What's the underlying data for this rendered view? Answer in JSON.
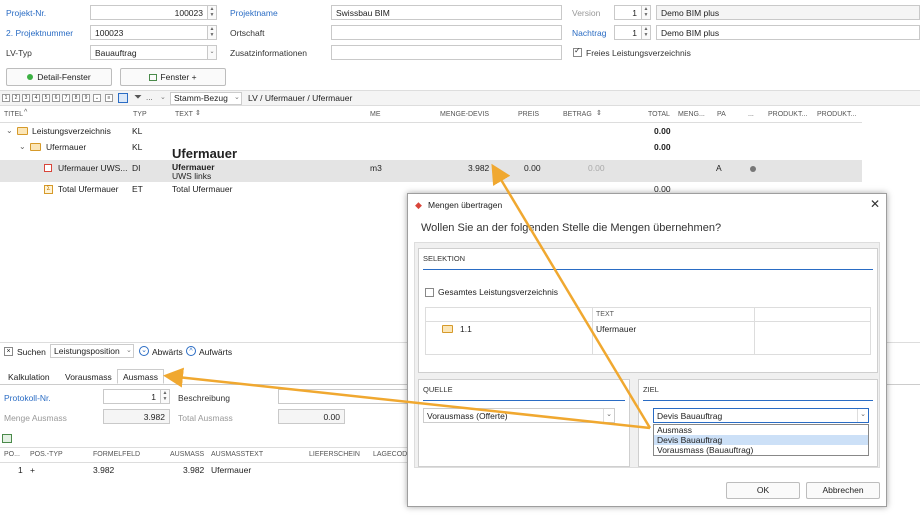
{
  "header": {
    "projekt_nr_label": "Projekt-Nr.",
    "projekt_nr_value": "100023",
    "projektname_label": "Projektname",
    "projektname_value": "Swissbau BIM",
    "version_label": "Version",
    "version_value": "1",
    "version_name": "Demo BIM plus",
    "zweite_nr_label": "2. Projektnummer",
    "zweite_nr_value": "100023",
    "ortschaft_label": "Ortschaft",
    "nachtrag_label": "Nachtrag",
    "nachtrag_value": "1",
    "nachtrag_name": "Demo BIM plus",
    "lv_typ_label": "LV-Typ",
    "lv_typ_value": "Bauauftrag",
    "zusatz_label": "Zusatzinformationen",
    "freies_lv_label": "Freies Leistungsverzeichnis",
    "detail_button": "Detail-Fenster",
    "fenster_button": "Fenster +"
  },
  "toolbar": {
    "levels": [
      "1",
      "2",
      "3",
      "4",
      "5",
      "6",
      "7",
      "8",
      "9"
    ],
    "filter_placeholder": "...",
    "stamm_bezug": "Stamm-Bezug",
    "breadcrumb": [
      "LV",
      "Ufermauer",
      "Ufermauer"
    ]
  },
  "grid": {
    "columns": [
      "TITEL",
      "TYP",
      "TEXT",
      "ME",
      "MENGE-DEVIS",
      "PREIS",
      "BETRAG",
      "TOTAL",
      "MENG...",
      "PA",
      "...",
      "PRODUKT...",
      "PRODUKT..."
    ],
    "rows": [
      {
        "titel": "Leistungsverzeichnis",
        "typ": "KL",
        "text": "",
        "me": "",
        "menge": "",
        "preis": "",
        "betrag": "",
        "total": "0.00",
        "pa": ""
      },
      {
        "titel": "Ufermauer",
        "typ": "KL",
        "text": "",
        "me": "",
        "menge": "",
        "preis": "",
        "betrag": "",
        "total": "0.00",
        "pa": ""
      },
      {
        "titel": "Ufermauer UWS...",
        "typ": "DI",
        "text": "Ufermauer",
        "text2": "UWS links",
        "me": "m3",
        "menge": "3.982",
        "preis": "0.00",
        "betrag": "0.00",
        "total": "",
        "pa": "A"
      },
      {
        "titel": "Total Ufermauer",
        "typ": "ET",
        "text": "Total Ufermauer",
        "me": "",
        "menge": "",
        "preis": "",
        "betrag": "",
        "total": "0.00",
        "pa": ""
      }
    ],
    "heading_overlay": "Ufermauer"
  },
  "search": {
    "label": "Suchen",
    "scope": "Leistungsposition",
    "down": "Abwärts",
    "up": "Aufwärts"
  },
  "tabs": [
    "Kalkulation",
    "Vorausmass",
    "Ausmass"
  ],
  "detail": {
    "protokoll_label": "Protokoll-Nr.",
    "protokoll_value": "1",
    "beschreibung_label": "Beschreibung",
    "menge_ausmass_label": "Menge Ausmass",
    "menge_ausmass_value": "3.982",
    "total_ausmass_label": "Total Ausmass",
    "total_ausmass_value": "0.00"
  },
  "bottom_grid": {
    "columns": [
      "PO...",
      "POS.-TYP",
      "FORMELFELD",
      "AUSMASS",
      "AUSMASSTEXT",
      "LIEFERSCHEIN",
      "LAGECOD"
    ],
    "rows": [
      {
        "po": "1",
        "typ": "+",
        "formel": "3.982",
        "ausmass": "3.982",
        "text": "Ufermauer"
      }
    ]
  },
  "dialog": {
    "title": "Mengen übertragen",
    "question": "Wollen Sie an der folgenden Stelle die Mengen übernehmen?",
    "selektion_title": "SELEKTION",
    "gesamt_label": "Gesamtes Leistungsverzeichnis",
    "sel_text_header": "TEXT",
    "sel_row_num": "1.1",
    "sel_row_text": "Ufermauer",
    "quelle_title": "QUELLE",
    "quelle_value": "Vorausmass (Offerte)",
    "ziel_title": "ZIEL",
    "ziel_value": "Devis Bauauftrag",
    "ziel_options": [
      "Ausmass",
      "Devis Bauauftrag",
      "Vorausmass (Bauauftrag)"
    ],
    "ok": "OK",
    "cancel": "Abbrechen"
  },
  "colors": {
    "accent": "#2a6cc4",
    "arrow": "#f0a830",
    "selected_row": "#e4e4e4"
  }
}
